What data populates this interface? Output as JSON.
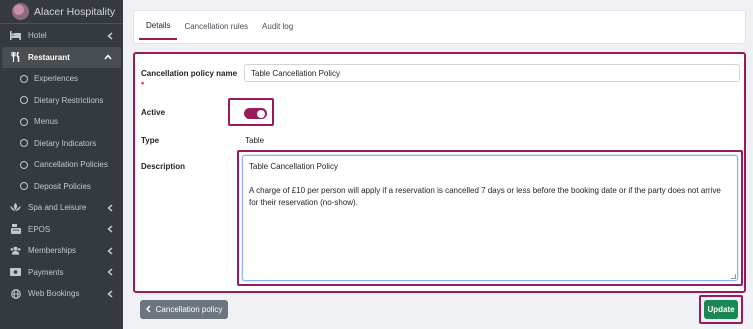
{
  "brand": {
    "name": "Alacer Hospitality"
  },
  "sidebar": {
    "items": [
      {
        "label": "Hotel",
        "icon": "bed-icon"
      },
      {
        "label": "Restaurant",
        "icon": "utensils-icon",
        "active": true,
        "expanded": true,
        "children": [
          {
            "label": "Experiences"
          },
          {
            "label": "Dietary Restrictions"
          },
          {
            "label": "Menus"
          },
          {
            "label": "Dietary Indicators"
          },
          {
            "label": "Cancellation Policies"
          },
          {
            "label": "Deposit Policies"
          }
        ]
      },
      {
        "label": "Spa and Leisure",
        "icon": "spa-icon"
      },
      {
        "label": "EPOS",
        "icon": "cash-register-icon"
      },
      {
        "label": "Memberships",
        "icon": "users-icon"
      },
      {
        "label": "Payments",
        "icon": "money-icon"
      },
      {
        "label": "Web Bookings",
        "icon": "globe-icon"
      }
    ]
  },
  "tabs": [
    {
      "label": "Details",
      "active": true
    },
    {
      "label": "Cancellation rules"
    },
    {
      "label": "Audit log"
    }
  ],
  "form": {
    "name_label": "Cancellation policy name",
    "required_mark": "•",
    "name_value": "Table Cancellation Policy",
    "active_label": "Active",
    "active_value": true,
    "type_label": "Type",
    "type_value": "Table",
    "description_label": "Description",
    "description_value": "Table Cancellation Policy\n\nA charge of £10 per person will apply if a reservation is cancelled 7 days or less before the booking date or if the party does not arrive for their reservation (no-show)."
  },
  "buttons": {
    "back_label": "Cancellation policy",
    "update_label": "Update"
  },
  "colors": {
    "accent": "#9b1b5a",
    "success": "#198754",
    "sidebar_bg": "#343a40",
    "secondary": "#6c757d"
  }
}
